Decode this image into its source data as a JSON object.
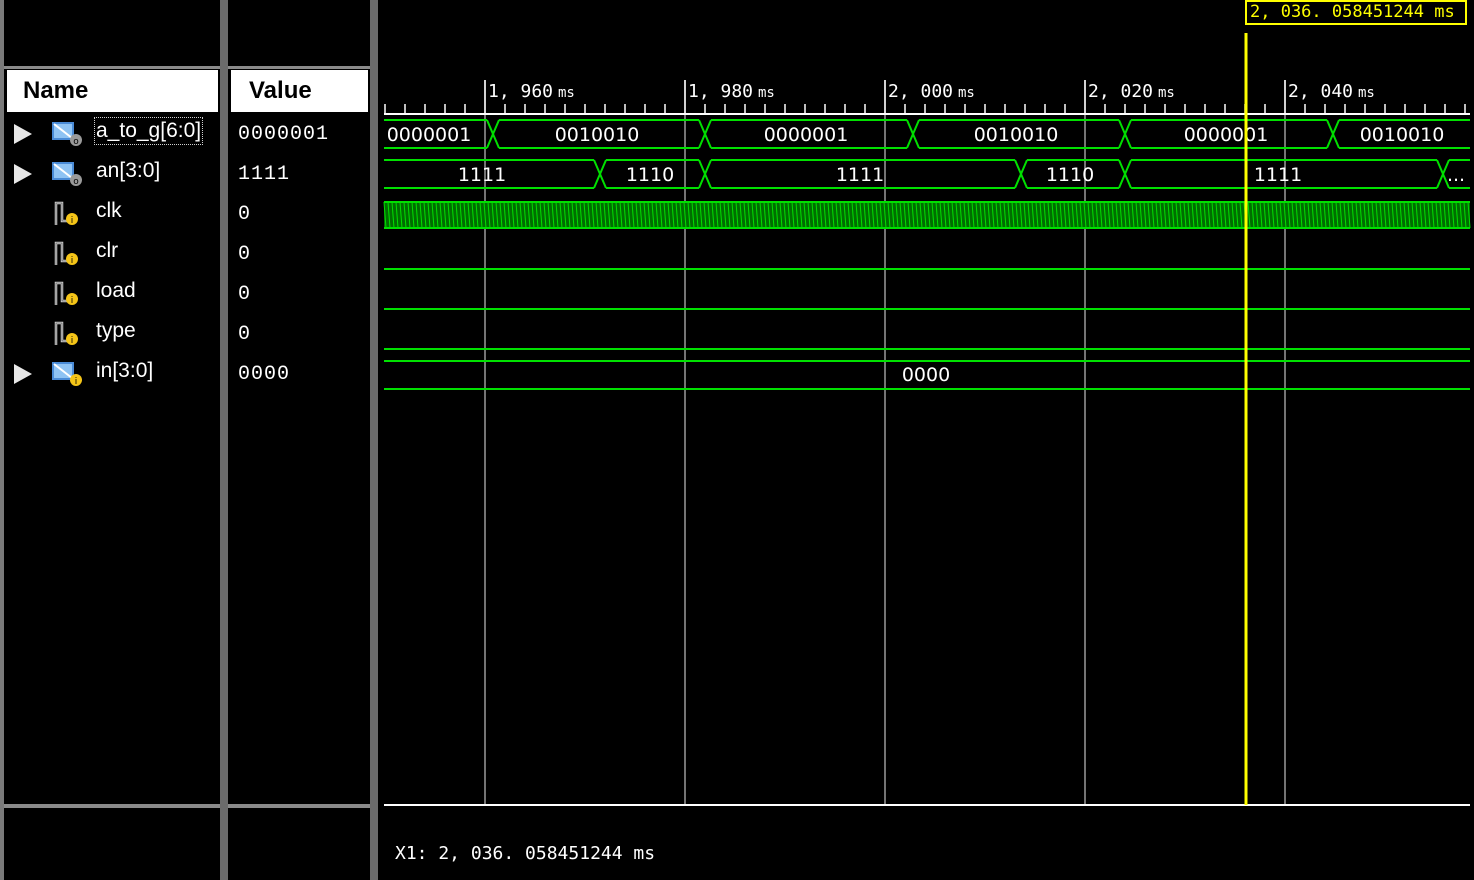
{
  "name_panel": {
    "header": "Name",
    "signals": [
      {
        "name": "a_to_g[6:0]",
        "type": "bus",
        "icon": "bus-output-icon",
        "expandable": true,
        "selected": true
      },
      {
        "name": "an[3:0]",
        "type": "bus",
        "icon": "bus-output-icon",
        "expandable": true,
        "selected": false
      },
      {
        "name": "clk",
        "type": "bit",
        "icon": "bit-input-icon",
        "expandable": false,
        "selected": false
      },
      {
        "name": "clr",
        "type": "bit",
        "icon": "bit-input-icon",
        "expandable": false,
        "selected": false
      },
      {
        "name": "load",
        "type": "bit",
        "icon": "bit-input-icon",
        "expandable": false,
        "selected": false
      },
      {
        "name": "type",
        "type": "bit",
        "icon": "bit-input-icon",
        "expandable": false,
        "selected": false
      },
      {
        "name": "in[3:0]",
        "type": "bus",
        "icon": "bus-input-icon",
        "expandable": true,
        "selected": false
      }
    ]
  },
  "value_panel": {
    "header": "Value",
    "values": [
      "0000001",
      "1111",
      "0",
      "0",
      "0",
      "0",
      "0000"
    ]
  },
  "timeline": {
    "unit": "ms",
    "major_ticks": [
      "1, 960",
      "1, 980",
      "2, 000",
      "2, 020",
      "2, 040"
    ],
    "cursor_label": "2, 036. 058451244  ms",
    "x1_readout": "X1: 2, 036. 058451244 ms"
  },
  "waveforms": {
    "a_to_g": [
      "0000001",
      "0010010",
      "0000001",
      "0010010",
      "0000001",
      "0010010"
    ],
    "an": [
      "1111",
      "1110",
      "1111",
      "1110",
      "1111",
      "..."
    ],
    "clk": "toggling",
    "clr": 0,
    "load": 0,
    "type": 0,
    "in": [
      "0000"
    ]
  },
  "colors": {
    "background": "#000000",
    "waveform": "#00e000",
    "cursor": "#ffff00",
    "gridline": "#9a9a9a",
    "text": "#ffffff"
  }
}
